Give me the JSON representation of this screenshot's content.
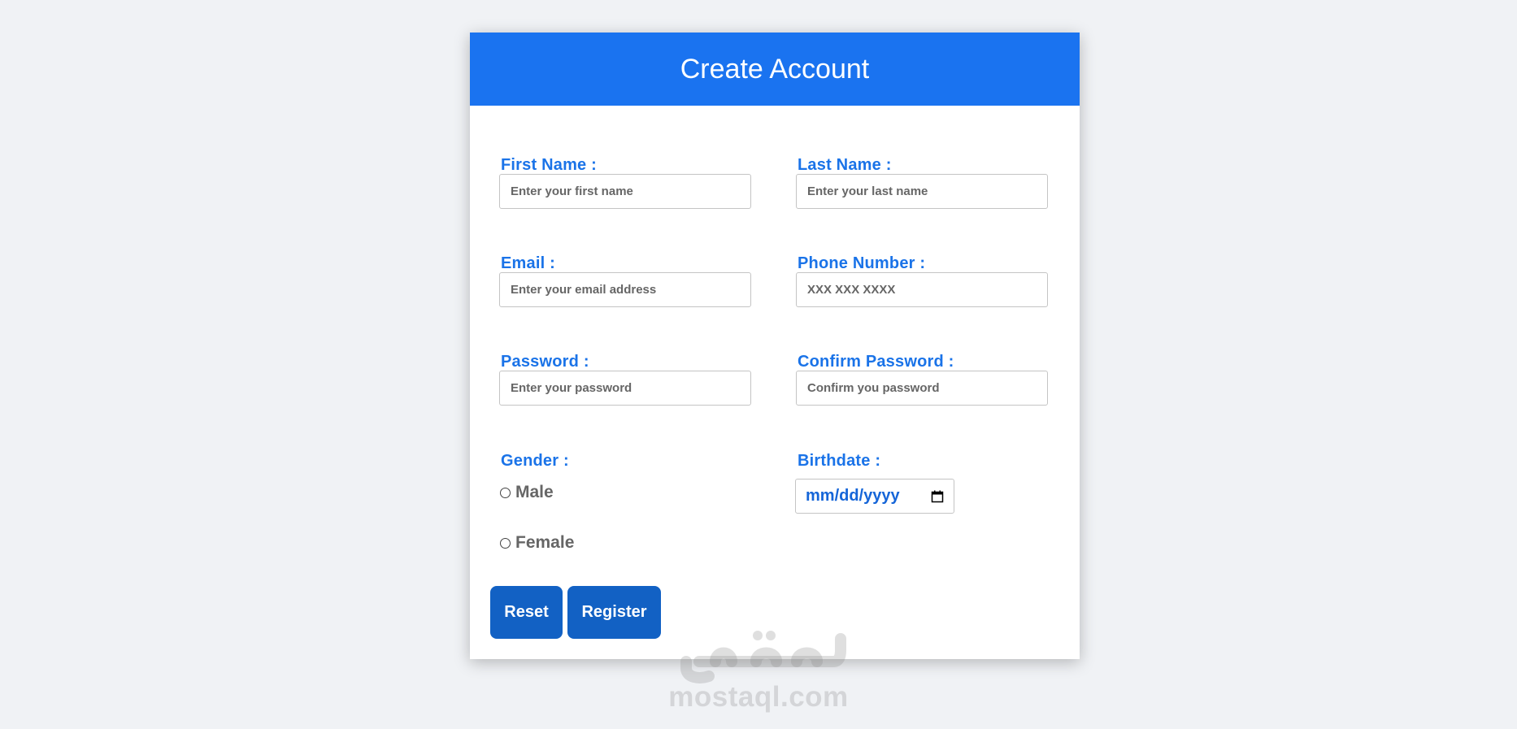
{
  "header": {
    "title": "Create Account"
  },
  "fields": {
    "first_name": {
      "label": "First Name :",
      "placeholder": "Enter your first name",
      "value": ""
    },
    "last_name": {
      "label": "Last Name :",
      "placeholder": "Enter your last name",
      "value": ""
    },
    "email": {
      "label": "Email :",
      "placeholder": "Enter your email address",
      "value": ""
    },
    "phone": {
      "label": "Phone Number :",
      "placeholder": "XXX XXX XXXX",
      "value": ""
    },
    "password": {
      "label": "Password :",
      "placeholder": "Enter your password",
      "value": ""
    },
    "confirm_password": {
      "label": "Confirm Password :",
      "placeholder": "Confirm you password",
      "value": ""
    }
  },
  "gender": {
    "label": "Gender :",
    "options": [
      {
        "label": "Male",
        "selected": false
      },
      {
        "label": "Female",
        "selected": false
      }
    ]
  },
  "birthdate": {
    "label": "Birthdate :",
    "placeholder": "mm/dd/yyyy",
    "icon": "calendar-icon"
  },
  "buttons": {
    "reset": "Reset",
    "register": "Register"
  },
  "watermark": {
    "text": "mostaql.com",
    "logo": "mostaql-logo"
  },
  "colors": {
    "header_bg": "#1a73f0",
    "label": "#1a73e8",
    "button_bg": "#1261c4",
    "page_bg": "#f0f2f5"
  }
}
